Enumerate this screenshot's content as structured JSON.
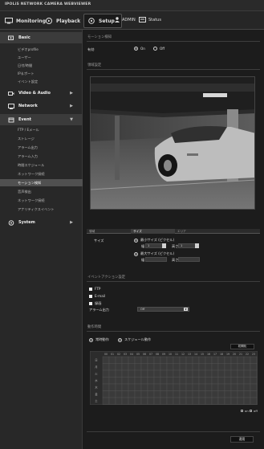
{
  "header": {
    "brand": "IPOLiS NETWORK CAMERA WEBVIEWER"
  },
  "topnav": {
    "monitoring": "Monitoring",
    "playback": "Playback",
    "setup": "Setup",
    "user": "ADMIN",
    "status": "Status"
  },
  "sidebar": {
    "categories": [
      {
        "label": "Basic",
        "icon": "camera-gear-icon",
        "open": true
      },
      {
        "label": "Video & Audio",
        "icon": "video-audio-icon"
      },
      {
        "label": "Network",
        "icon": "network-icon"
      },
      {
        "label": "Event",
        "icon": "event-icon",
        "open": true
      },
      {
        "label": "System",
        "icon": "system-gear-icon"
      }
    ],
    "basic_items": [
      "ビデオprofile",
      "ユーザー",
      "日付/時間",
      "IP＆ポート",
      "イベント設定"
    ],
    "event_items": [
      "FTP / Eメール",
      "ストレージ",
      "アラーム出力",
      "アラーム入力",
      "時間スケジュール",
      "ネットワーク接続",
      "モーション検知",
      "音声検出",
      "ネットワーク接続",
      "アナリティクスイベント"
    ],
    "active_item": "モーション検知"
  },
  "main": {
    "section_motion": "モーション検知",
    "enable_label": "有効",
    "on_label": "On",
    "off_label": "Off",
    "enable_value": "On",
    "section_area": "領域設定",
    "zone_tabs": [
      "領域",
      "サイズ",
      "エリア"
    ],
    "active_zone_tab": "サイズ",
    "size_label": "サイズ",
    "min_size_label": "最小サイズ (ピクセル)",
    "max_size_label": "最大サイズ (ピクセル)",
    "width_label": "幅",
    "height_label": "高さ",
    "min_width": "1",
    "min_height": "1",
    "max_width": "",
    "max_height": "",
    "section_action": "イベントアクション設定",
    "actions": [
      "FTP",
      "E-mail",
      "録画"
    ],
    "alarm_label": "アラーム出力",
    "alarm_value": "Off",
    "section_schedule": "動作時間",
    "schedule_always": "常時動作",
    "schedule_only": "スケジュール動作",
    "schedule_selected": "常時動作",
    "reset_label": "初期化",
    "hours": [
      "00",
      "01",
      "02",
      "03",
      "04",
      "05",
      "06",
      "07",
      "08",
      "09",
      "10",
      "11",
      "12",
      "13",
      "14",
      "15",
      "16",
      "17",
      "18",
      "19",
      "20",
      "21",
      "22",
      "23"
    ],
    "days": [
      "日",
      "月",
      "火",
      "水",
      "木",
      "金",
      "土"
    ],
    "legend_on": "on",
    "legend_off": "off",
    "apply_label": "適用"
  }
}
